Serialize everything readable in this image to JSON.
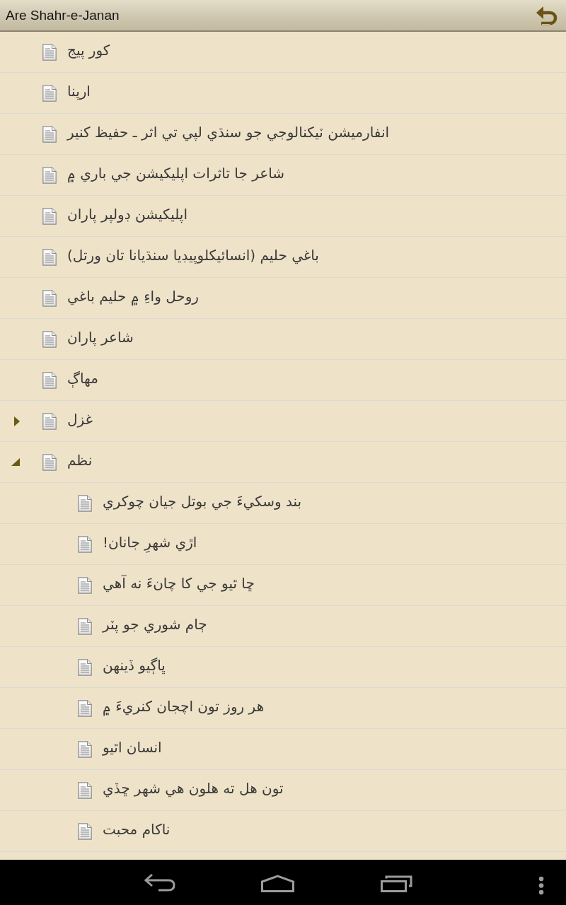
{
  "action_bar": {
    "title": "Are Shahr-e-Janan"
  },
  "tree": [
    {
      "kind": "page",
      "label": "کور پيج"
    },
    {
      "kind": "page",
      "label": "ارپنا"
    },
    {
      "kind": "page",
      "label": "انفارميشن ٽيکنالوجي جو سنڌي لپي تي اثر ـ حفيظ کنير"
    },
    {
      "kind": "page",
      "label": "شاعر جا تاثرات اپليکيشن جي باري ۾"
    },
    {
      "kind": "page",
      "label": "اپليکيشن ڊولپر پاران"
    },
    {
      "kind": "page",
      "label": "باغي حليم (انسائيکلوپيڊيا سنڌيانا تان ورتل)"
    },
    {
      "kind": "page",
      "label": "روحل واءِ ۾ حليم باغي"
    },
    {
      "kind": "page",
      "label": "شاعر پاران"
    },
    {
      "kind": "page",
      "label": "مهاڳ"
    },
    {
      "kind": "group",
      "label": "غزل",
      "expanded": false
    },
    {
      "kind": "group",
      "label": "نظم",
      "expanded": true,
      "children": [
        {
          "kind": "page",
          "label": "بند وسکيءَ جي بوتل جيان چوکري"
        },
        {
          "kind": "page",
          "label": "اڙي شهرِ جانان!"
        },
        {
          "kind": "page",
          "label": "ڇا ٿيو جي کا چانءَ نه آهي"
        },
        {
          "kind": "page",
          "label": "ڄام شوري جو پٽر"
        },
        {
          "kind": "page",
          "label": "ڀاڳيو ڏينهن"
        },
        {
          "kind": "page",
          "label": "هر روز تون اچجان کنريءَ ۾"
        },
        {
          "kind": "page",
          "label": "انسان اٿيو"
        },
        {
          "kind": "page",
          "label": "تون هل ته هلون هي شهر ڇڏي"
        },
        {
          "kind": "page",
          "label": "ناکام محبت"
        }
      ]
    }
  ]
}
